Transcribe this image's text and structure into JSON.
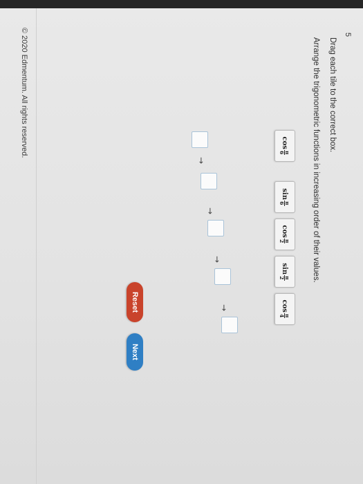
{
  "question": {
    "number": "5",
    "instruction_primary": "Drag each tile to the correct box.",
    "instruction_secondary": "Arrange the trigonometric functions in increasing order of their values."
  },
  "tiles": [
    {
      "fn": "cos",
      "num": "π",
      "den": "6"
    },
    {
      "fn": "sin",
      "num": "π",
      "den": "6"
    },
    {
      "fn": "cos",
      "num": "π",
      "den": "2"
    },
    {
      "fn": "sin",
      "num": "π",
      "den": "2"
    },
    {
      "fn": "cos",
      "num": "π",
      "den": "4"
    }
  ],
  "arrow_glyph": "→",
  "buttons": {
    "reset": "Reset",
    "next": "Next"
  },
  "colors": {
    "reset": "#c9432b",
    "next": "#2f7fc4"
  },
  "footer": {
    "copyright": "© 2020 Edmentum. All rights reserved."
  }
}
